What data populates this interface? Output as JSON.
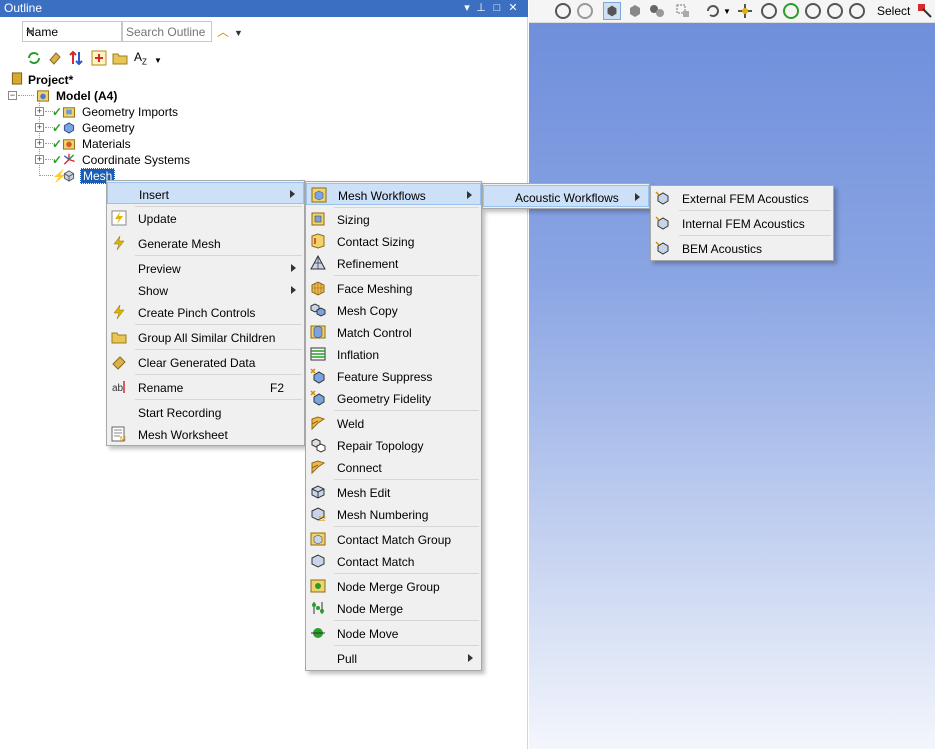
{
  "outline": {
    "title": "Outline",
    "filter_select": "Name",
    "search_placeholder": "Search Outline",
    "tree": {
      "project": "Project*",
      "model": "Model (A4)",
      "children": [
        "Geometry Imports",
        "Geometry",
        "Materials",
        "Coordinate Systems"
      ],
      "mesh": "Mesh"
    }
  },
  "viewport": {
    "select_label": "Select"
  },
  "context_menu": {
    "items": [
      {
        "label": "Insert",
        "submenu": true
      },
      {
        "label": "Update"
      },
      {
        "label": "Generate Mesh"
      },
      {
        "label": "Preview",
        "submenu": true
      },
      {
        "label": "Show",
        "submenu": true
      },
      {
        "label": "Create Pinch Controls"
      },
      {
        "label": "Group All Similar Children"
      },
      {
        "label": "Clear Generated Data"
      },
      {
        "label": "Rename",
        "shortcut": "F2"
      },
      {
        "label": "Start Recording"
      },
      {
        "label": "Mesh Worksheet"
      }
    ]
  },
  "insert_menu": {
    "items": [
      {
        "label": "Mesh Workflows",
        "submenu": true
      },
      {
        "label": "Sizing"
      },
      {
        "label": "Contact Sizing"
      },
      {
        "label": "Refinement"
      },
      {
        "label": "Face Meshing"
      },
      {
        "label": "Mesh Copy"
      },
      {
        "label": "Match Control"
      },
      {
        "label": "Inflation"
      },
      {
        "label": "Feature Suppress"
      },
      {
        "label": "Geometry Fidelity"
      },
      {
        "label": "Weld"
      },
      {
        "label": "Repair Topology"
      },
      {
        "label": "Connect"
      },
      {
        "label": "Mesh Edit"
      },
      {
        "label": "Mesh Numbering"
      },
      {
        "label": "Contact Match Group"
      },
      {
        "label": "Contact Match"
      },
      {
        "label": "Node Merge Group"
      },
      {
        "label": "Node Merge"
      },
      {
        "label": "Node Move"
      },
      {
        "label": "Pull",
        "submenu": true
      }
    ]
  },
  "workflows_menu": {
    "items": [
      {
        "label": "Acoustic Workflows",
        "submenu": true
      }
    ]
  },
  "acoustic_menu": {
    "items": [
      {
        "label": "External FEM Acoustics"
      },
      {
        "label": "Internal FEM Acoustics"
      },
      {
        "label": "BEM Acoustics"
      }
    ]
  },
  "colors": {
    "titlebar": "#3b6fc1",
    "highlight": "#cce0f7",
    "viewport_top": "#6f8fdc",
    "viewport_bottom": "#f3f6fc"
  }
}
